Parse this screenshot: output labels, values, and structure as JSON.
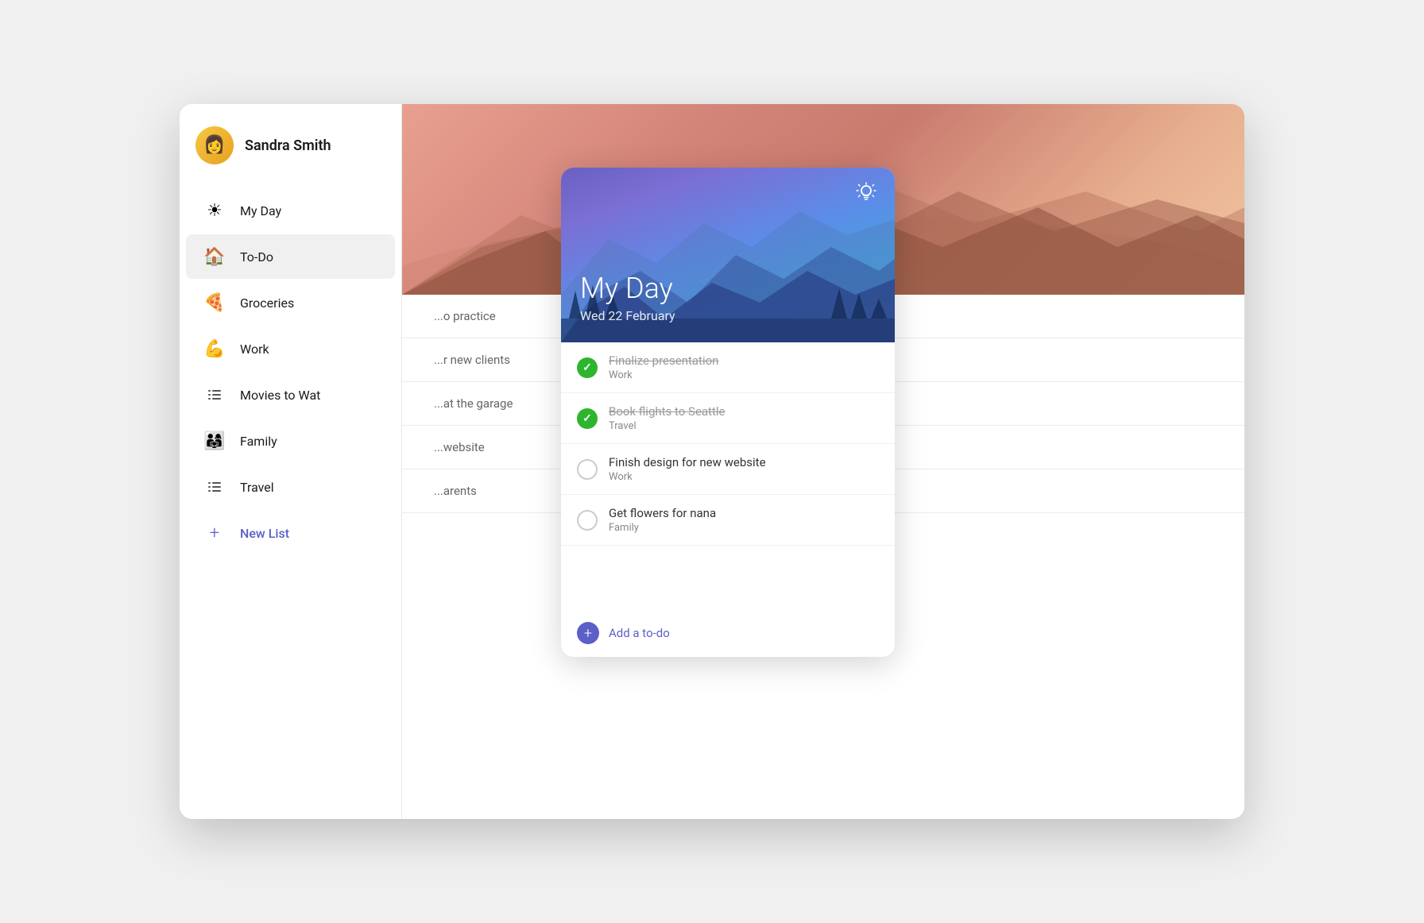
{
  "user": {
    "name": "Sandra Smith",
    "avatar_emoji": "👩"
  },
  "sidebar": {
    "nav_items": [
      {
        "id": "my-day",
        "label": "My Day",
        "icon": "☀",
        "active": false
      },
      {
        "id": "todo",
        "label": "To-Do",
        "icon": "🏠",
        "active": true
      },
      {
        "id": "groceries",
        "label": "Groceries",
        "icon": "🍕",
        "active": false
      },
      {
        "id": "work",
        "label": "Work",
        "icon": "💪",
        "active": false
      },
      {
        "id": "movies",
        "label": "Movies to Wat",
        "icon": "≡",
        "active": false
      },
      {
        "id": "family",
        "label": "Family",
        "icon": "👨‍👩‍👧",
        "active": false
      },
      {
        "id": "travel",
        "label": "Travel",
        "icon": "≡",
        "active": false
      }
    ],
    "new_list_label": "New List"
  },
  "myday_popup": {
    "title": "My Day",
    "subtitle": "Wed 22 February",
    "tasks": [
      {
        "id": 1,
        "name": "Finalize presentation",
        "list": "Work",
        "completed": true
      },
      {
        "id": 2,
        "name": "Book flights to Seattle",
        "list": "Travel",
        "completed": true
      },
      {
        "id": 3,
        "name": "Finish design for new website",
        "list": "Work",
        "completed": false
      },
      {
        "id": 4,
        "name": "Get flowers for nana",
        "list": "Family",
        "completed": false
      }
    ],
    "add_label": "Add a to-do",
    "light_icon": "💡"
  },
  "main_tasks": [
    {
      "id": 1,
      "text": "...o practice"
    },
    {
      "id": 2,
      "text": "...r new clients"
    },
    {
      "id": 3,
      "text": "...at the garage"
    },
    {
      "id": 4,
      "text": "...website"
    },
    {
      "id": 5,
      "text": "...arents"
    }
  ]
}
